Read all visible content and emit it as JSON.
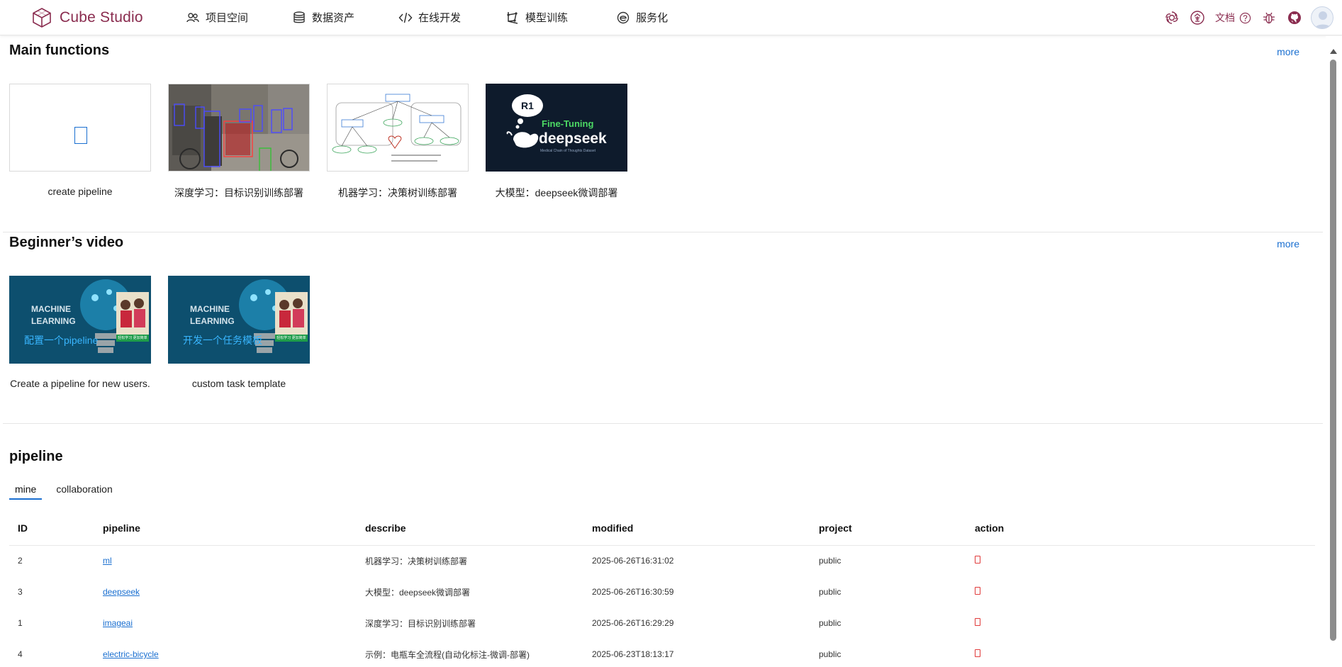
{
  "app": {
    "name": "Cube Studio",
    "brand_color": "#8a2c4f",
    "accent_color": "#1a6fd0"
  },
  "nav": [
    {
      "label": "项目空间",
      "icon": "users-icon"
    },
    {
      "label": "数据资产",
      "icon": "database-icon"
    },
    {
      "label": "在线开发",
      "icon": "code-icon"
    },
    {
      "label": "模型训练",
      "icon": "train-icon"
    },
    {
      "label": "服务化",
      "icon": "service-icon"
    }
  ],
  "header_right": {
    "docs_label": "文档",
    "icons": [
      "openai-icon",
      "enterprise-icon",
      "help-icon",
      "bug-icon",
      "github-icon",
      "avatar"
    ]
  },
  "main_functions": {
    "title": "Main functions",
    "more": "more",
    "cards": [
      {
        "caption": "create pipeline",
        "thumb": "placeholder"
      },
      {
        "caption": "深度学习：目标识别训练部署",
        "thumb": "street-detection"
      },
      {
        "caption": "机器学习：决策树训练部署",
        "thumb": "decision-tree"
      },
      {
        "caption": "大模型：deepseek微调部署",
        "thumb": "deepseek",
        "thumb_text": {
          "badge": "R1",
          "line1": "Fine-Tuning",
          "line2": "deepseek",
          "line3": "Medical Chain of Thoughts Dataset"
        }
      }
    ]
  },
  "beginner_video": {
    "title": "Beginner’s video",
    "more": "more",
    "cards": [
      {
        "caption": "Create a pipeline for new users.",
        "overlay_title": "MACHINE LEARNING",
        "overlay_sub": "配置一个pipeline",
        "badge": "轻松学习 更加简单"
      },
      {
        "caption": "custom task template",
        "overlay_title": "MACHINE LEARNING",
        "overlay_sub": "开发一个任务模板",
        "badge": "轻松学习 更加简单"
      }
    ]
  },
  "pipeline": {
    "title": "pipeline",
    "tabs": [
      {
        "label": "mine",
        "active": true
      },
      {
        "label": "collaboration",
        "active": false
      }
    ],
    "columns": [
      "ID",
      "pipeline",
      "describe",
      "modified",
      "project",
      "action"
    ],
    "rows": [
      {
        "id": "2",
        "name": "ml",
        "describe": "机器学习：决策树训练部署",
        "modified": "2025-06-26T16:31:02",
        "project": "public"
      },
      {
        "id": "3",
        "name": "deepseek",
        "describe": "大模型：deepseek微调部署",
        "modified": "2025-06-26T16:30:59",
        "project": "public"
      },
      {
        "id": "1",
        "name": "imageai",
        "describe": "深度学习：目标识别训练部署",
        "modified": "2025-06-26T16:29:29",
        "project": "public"
      },
      {
        "id": "4",
        "name": "electric-bicycle",
        "describe": "示例：电瓶车全流程(自动化标注-微调-部署)",
        "modified": "2025-06-23T18:13:17",
        "project": "public"
      }
    ]
  }
}
